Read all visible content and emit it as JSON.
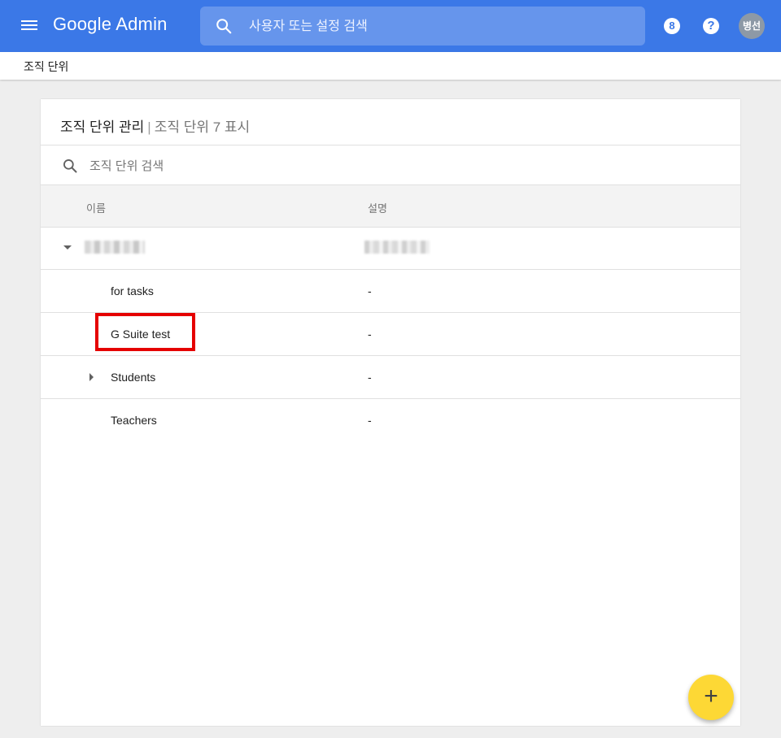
{
  "header": {
    "app_title": "Google Admin",
    "search_placeholder": "사용자 또는 설정 검색",
    "badge_value": "8",
    "help_glyph": "?",
    "avatar_initials": "병선",
    "bar_color": "#3b78e7"
  },
  "breadcrumb": {
    "current": "조직 단위"
  },
  "panel": {
    "title": "조직 단위 관리",
    "separator": "|",
    "subtitle": "조직 단위 7 표시",
    "search_placeholder": "조직 단위 검색",
    "columns": {
      "name": "이름",
      "description": "설명"
    },
    "rows": [
      {
        "name": "for tasks",
        "description": "-"
      },
      {
        "name": "G Suite test",
        "description": "-"
      },
      {
        "name": "Students",
        "description": "-"
      },
      {
        "name": "Teachers",
        "description": "-"
      }
    ]
  },
  "fab": {
    "label": "+",
    "color": "#fdd835"
  },
  "annotation_color": "#e50000",
  "icons": [
    "menu-icon",
    "search-icon",
    "notification-badge-icon",
    "help-icon",
    "expand-down-icon",
    "expand-right-icon",
    "add-icon"
  ]
}
